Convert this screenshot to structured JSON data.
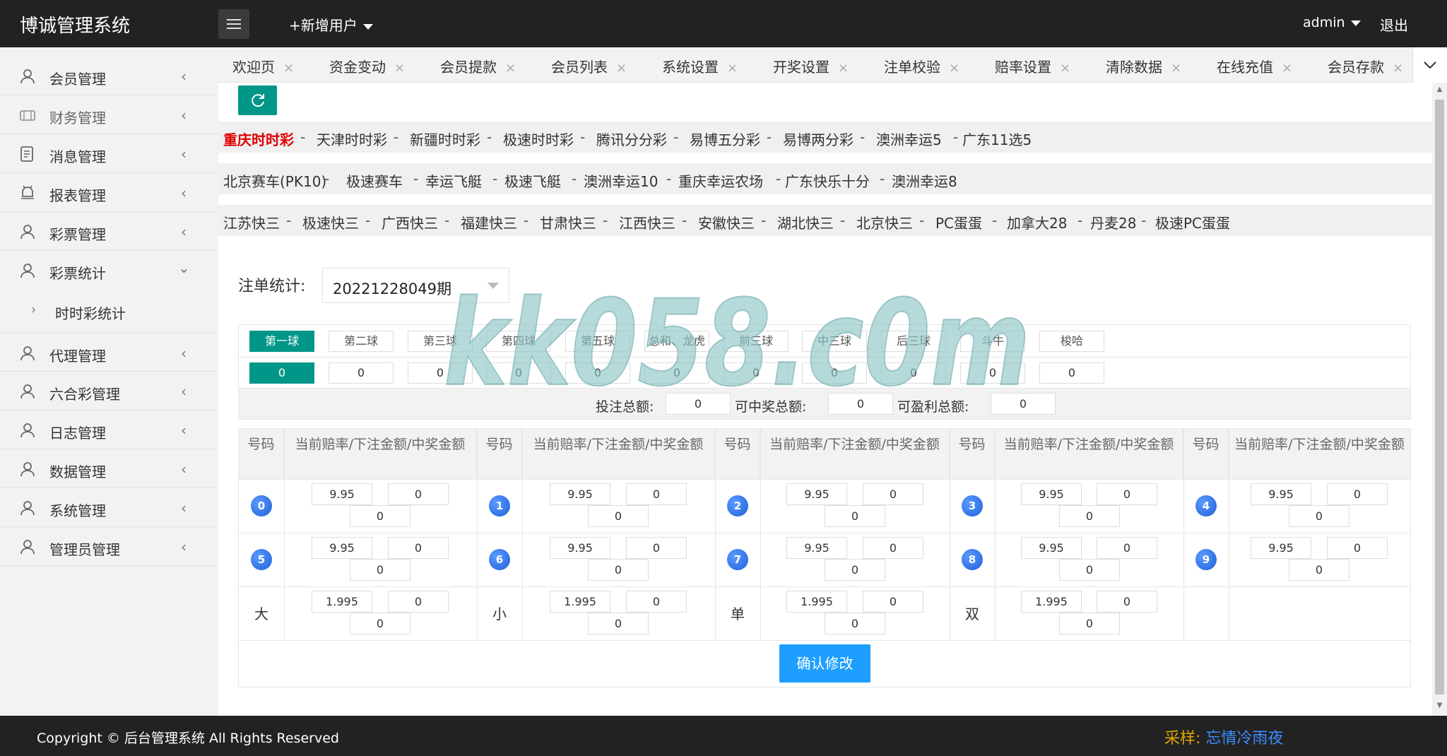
{
  "header": {
    "brand": "博诚管理系统",
    "add_user": "+新增用户",
    "admin": "admin",
    "logout": "退出"
  },
  "sidebar": {
    "items": [
      {
        "label": "会员管理",
        "icon": "user-icon"
      },
      {
        "label": "财务管理",
        "icon": "wallet-icon"
      },
      {
        "label": "消息管理",
        "icon": "message-icon"
      },
      {
        "label": "报表管理",
        "icon": "report-icon"
      },
      {
        "label": "彩票管理",
        "icon": "user-icon"
      },
      {
        "label": "彩票统计",
        "icon": "user-icon"
      },
      {
        "label": "代理管理",
        "icon": "user-icon"
      },
      {
        "label": "六合彩管理",
        "icon": "user-icon"
      },
      {
        "label": "日志管理",
        "icon": "user-icon"
      },
      {
        "label": "数据管理",
        "icon": "user-icon"
      },
      {
        "label": "系统管理",
        "icon": "user-icon"
      },
      {
        "label": "管理员管理",
        "icon": "user-icon"
      }
    ],
    "sub_item": "时时彩统计"
  },
  "tabs": [
    "欢迎页",
    "资金变动",
    "会员提款",
    "会员列表",
    "系统设置",
    "开奖设置",
    "注单校验",
    "赔率设置",
    "清除数据",
    "在线充值",
    "会员存款"
  ],
  "lotteries": {
    "row1": [
      "重庆时时彩",
      "天津时时彩",
      "新疆时时彩",
      "极速时时彩",
      "腾讯分分彩",
      "易博五分彩",
      "易博两分彩",
      "澳洲幸运5",
      "广东11选5"
    ],
    "row2": [
      "北京赛车(PK10)",
      "极速赛车",
      "幸运飞艇",
      "极速飞艇",
      "澳洲幸运10",
      "重庆幸运农场",
      "广东快乐十分",
      "澳洲幸运8"
    ],
    "row3": [
      "江苏快三",
      "极速快三",
      "广西快三",
      "福建快三",
      "甘肃快三",
      "江西快三",
      "安徽快三",
      "湖北快三",
      "北京快三",
      "PC蛋蛋",
      "加拿大28",
      "丹麦28",
      "极速PC蛋蛋"
    ],
    "separator": "-"
  },
  "stats": {
    "label": "注单统计:",
    "issue": "20221228049期"
  },
  "balls": {
    "tabs": [
      "第一球",
      "第二球",
      "第三球",
      "第四球",
      "第五球",
      "总和、龙虎",
      "前三球",
      "中三球",
      "后三球",
      "斗牛",
      "梭哈"
    ],
    "values": [
      "0",
      "0",
      "0",
      "0",
      "0",
      "0",
      "0",
      "0",
      "0",
      "0",
      "0"
    ]
  },
  "totals": {
    "bet_label": "投注总额:",
    "bet_value": "0",
    "win_label": "可中奖总额:",
    "win_value": "0",
    "profit_label": "可盈利总额:",
    "profit_value": "0"
  },
  "odds_table": {
    "code_header": "号码",
    "odds_header": "当前赔率/下注金额/中奖金额",
    "rows": [
      [
        {
          "code": "0",
          "odds": "9.95",
          "bet": "0",
          "win": "0"
        },
        {
          "code": "1",
          "odds": "9.95",
          "bet": "0",
          "win": "0"
        },
        {
          "code": "2",
          "odds": "9.95",
          "bet": "0",
          "win": "0"
        },
        {
          "code": "3",
          "odds": "9.95",
          "bet": "0",
          "win": "0"
        },
        {
          "code": "4",
          "odds": "9.95",
          "bet": "0",
          "win": "0"
        }
      ],
      [
        {
          "code": "5",
          "odds": "9.95",
          "bet": "0",
          "win": "0"
        },
        {
          "code": "6",
          "odds": "9.95",
          "bet": "0",
          "win": "0"
        },
        {
          "code": "7",
          "odds": "9.95",
          "bet": "0",
          "win": "0"
        },
        {
          "code": "8",
          "odds": "9.95",
          "bet": "0",
          "win": "0"
        },
        {
          "code": "9",
          "odds": "9.95",
          "bet": "0",
          "win": "0"
        }
      ],
      [
        {
          "code": "大",
          "odds": "1.995",
          "bet": "0",
          "win": "0"
        },
        {
          "code": "小",
          "odds": "1.995",
          "bet": "0",
          "win": "0"
        },
        {
          "code": "单",
          "odds": "1.995",
          "bet": "0",
          "win": "0"
        },
        {
          "code": "双",
          "odds": "1.995",
          "bet": "0",
          "win": "0"
        }
      ]
    ],
    "confirm": "确认修改"
  },
  "footer": {
    "copyright": "Copyright © 后台管理系统 All Rights Reserved",
    "credit_key": "采样:",
    "credit_value": "忘情冷雨夜"
  },
  "watermark": "kk058.c0m",
  "colors": {
    "primary": "#009688",
    "blue": "#1e9fff",
    "active_lottery": "#e00000",
    "header": "#222222"
  }
}
